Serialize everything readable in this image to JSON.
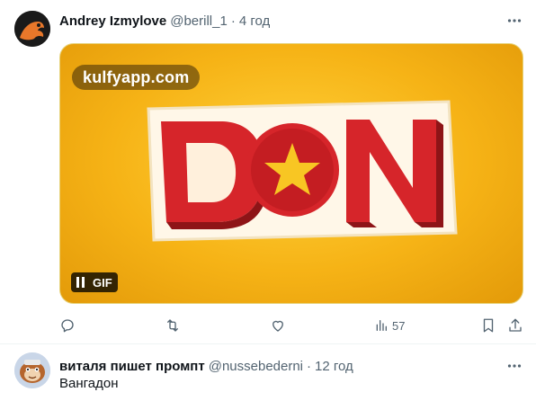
{
  "tweets": [
    {
      "author": "Andrey Izmylove",
      "handle": "@berill_1",
      "separator": "·",
      "time": "4 год",
      "media": {
        "watermark": "kulfyapp.com",
        "logo_text": "DON",
        "gif_label": "GIF"
      },
      "actions": {
        "reply": "",
        "retweet": "",
        "like": "",
        "views": "57"
      }
    },
    {
      "author": "виталя пишет промпт",
      "handle": "@nussebederni",
      "separator": "·",
      "time": "12 год",
      "text": "Вангадон"
    }
  ],
  "colors": {
    "text": "#0f1419",
    "secondary": "#536471",
    "gif_yellow": "#f6b316",
    "logo_red": "#d6252a"
  }
}
